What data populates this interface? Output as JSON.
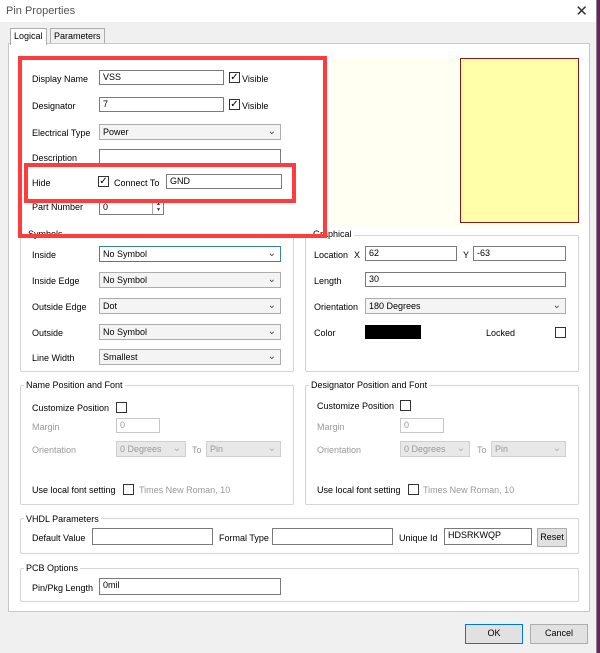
{
  "window": {
    "title": "Pin Properties",
    "close_glyph": "✕"
  },
  "tabs": [
    "Logical",
    "Parameters"
  ],
  "logical": {
    "display_name": {
      "label": "Display Name",
      "value": "VSS",
      "visible_label": "Visible"
    },
    "designator": {
      "label": "Designator",
      "value": "7",
      "visible_label": "Visible"
    },
    "electrical_type": {
      "label": "Electrical Type",
      "value": "Power"
    },
    "description": {
      "label": "Description",
      "value": ""
    },
    "hide": {
      "label": "Hide",
      "connect_to_label": "Connect To",
      "connect_to_value": "GND"
    },
    "part_number": {
      "label": "Part Number",
      "value": "0"
    }
  },
  "symbols": {
    "title": "Symbols",
    "inside": {
      "label": "Inside",
      "value": "No Symbol"
    },
    "inside_edge": {
      "label": "Inside Edge",
      "value": "No Symbol"
    },
    "outside_edge": {
      "label": "Outside Edge",
      "value": "Dot"
    },
    "outside": {
      "label": "Outside",
      "value": "No Symbol"
    },
    "line_width": {
      "label": "Line Width",
      "value": "Smallest"
    }
  },
  "graphical": {
    "title": "Graphical",
    "location_label": "Location",
    "x_label": "X",
    "x_value": "62",
    "y_label": "Y",
    "y_value": "-63",
    "length_label": "Length",
    "length_value": "30",
    "orientation_label": "Orientation",
    "orientation_value": "180 Degrees",
    "color_label": "Color",
    "color_value": "#000000",
    "locked_label": "Locked"
  },
  "name_font": {
    "title": "Name Position and Font",
    "customize_label": "Customize Position",
    "margin_label": "Margin",
    "margin_value": "0",
    "orientation_label": "Orientation",
    "orientation_value": "0 Degrees",
    "to_label": "To",
    "to_value": "Pin",
    "local_font_label": "Use local font setting",
    "font_value": "Times New Roman, 10"
  },
  "designator_font": {
    "title": "Designator Position and Font",
    "customize_label": "Customize Position",
    "margin_label": "Margin",
    "margin_value": "0",
    "orientation_label": "Orientation",
    "orientation_value": "0 Degrees",
    "to_label": "To",
    "to_value": "Pin",
    "local_font_label": "Use local font setting",
    "font_value": "Times New Roman, 10"
  },
  "vhdl": {
    "title": "VHDL Parameters",
    "default_value_label": "Default Value",
    "default_value": "",
    "formal_type_label": "Formal Type",
    "formal_type": "",
    "unique_id_label": "Unique Id",
    "unique_id": "HDSRKWQP",
    "reset_label": "Reset"
  },
  "pcb": {
    "title": "PCB Options",
    "pin_pkg_length_label": "Pin/Pkg Length",
    "pin_pkg_length_value": "0mil"
  },
  "footer": {
    "ok_label": "OK",
    "cancel_label": "Cancel"
  },
  "icons": {
    "check": "✓",
    "dropdown": "chevron-down"
  },
  "colors": {
    "annotation_red": "#ff3b3b",
    "preview_pin": "#ffffaa",
    "accent": "#0078d7"
  }
}
